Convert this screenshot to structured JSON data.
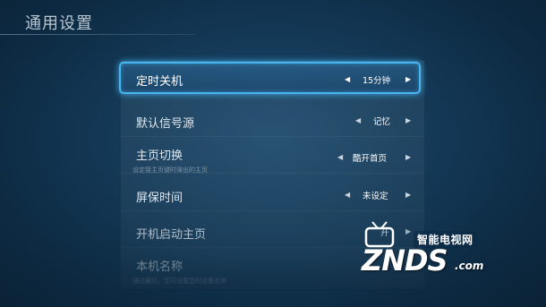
{
  "header": {
    "title": "通用设置"
  },
  "settings": [
    {
      "label": "定时关机",
      "value": "15分钟",
      "focused": true
    },
    {
      "label": "默认信号源",
      "value": "记忆"
    },
    {
      "label": "主页切换",
      "sub": "设定接主页键时弹出的主页",
      "value": "酷开首页"
    },
    {
      "label": "屏保时间",
      "value": "未设定"
    },
    {
      "label": "开机启动主页",
      "value": "开"
    },
    {
      "label": "本机名称",
      "sub": "通过藏坊，您可设置您的设备名称"
    }
  ],
  "icons": {
    "left": "◀",
    "right": "▶"
  },
  "watermark": {
    "cn": "智能电视网",
    "brand": "ZNDS",
    "domain": ".com"
  },
  "colors": {
    "focus": "#47b6f0",
    "background": "#143a58"
  }
}
